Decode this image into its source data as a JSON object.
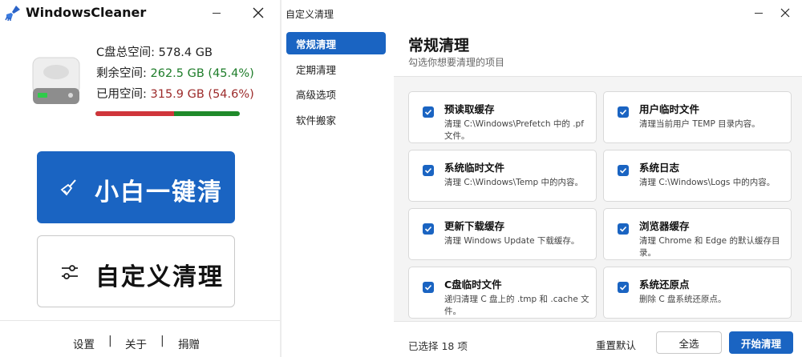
{
  "main_window": {
    "title": "WindowsCleaner",
    "app_icon": "broom-icon",
    "disk_icon": "hard-drive-icon",
    "stats": [
      {
        "label": "C盘总空间: ",
        "value": "578.4 GB"
      },
      {
        "label": "剩余空间: ",
        "value": "262.5 GB (45.4%)",
        "color": "#1e7d2a"
      },
      {
        "label": "已用空间: ",
        "value": "315.9 GB (54.6%)",
        "color": "#9c2a2a"
      }
    ],
    "usage_fraction": 0.546,
    "one_click_label": "小白一键清",
    "one_click_icon": "broom-icon",
    "custom_clean_label": "自定义清理",
    "custom_clean_icon": "sliders-icon",
    "footer": {
      "settings": "设置",
      "about": "关于",
      "donate": "捐赠",
      "separator": "|"
    }
  },
  "custom_window": {
    "title": "自定义清理",
    "nav": [
      {
        "label": "常规清理",
        "active": true
      },
      {
        "label": "定期清理",
        "active": false
      },
      {
        "label": "高级选项",
        "active": false
      },
      {
        "label": "软件搬家",
        "active": false
      }
    ],
    "section_title": "常规清理",
    "section_subtitle": "勾选你想要清理的项目",
    "items": [
      {
        "title": "预读取缓存",
        "desc": "清理 C:\\Windows\\Prefetch 中的 .pf 文件。",
        "checked": true
      },
      {
        "title": "用户临时文件",
        "desc": "清理当前用户 TEMP 目录内容。",
        "checked": true
      },
      {
        "title": "系统临时文件",
        "desc": "清理 C:\\Windows\\Temp 中的内容。",
        "checked": true
      },
      {
        "title": "系统日志",
        "desc": "清理 C:\\Windows\\Logs 中的内容。",
        "checked": true
      },
      {
        "title": "更新下载缓存",
        "desc": "清理 Windows Update 下载缓存。",
        "checked": true
      },
      {
        "title": "浏览器缓存",
        "desc": "清理 Chrome 和 Edge 的默认缓存目录。",
        "checked": true
      },
      {
        "title": "C盘临时文件",
        "desc": "递归清理 C 盘上的 .tmp 和 .cache 文件。",
        "checked": true
      },
      {
        "title": "系统还原点",
        "desc": "删除 C 盘系统还原点。",
        "checked": true
      }
    ],
    "selected_count": "已选择 18 项",
    "reset_label": "重置默认",
    "select_all_label": "全选",
    "start_label": "开始清理"
  },
  "colors": {
    "accent": "#1a64c2",
    "free_green": "#1e7d2a",
    "used_red": "#d0353b"
  }
}
